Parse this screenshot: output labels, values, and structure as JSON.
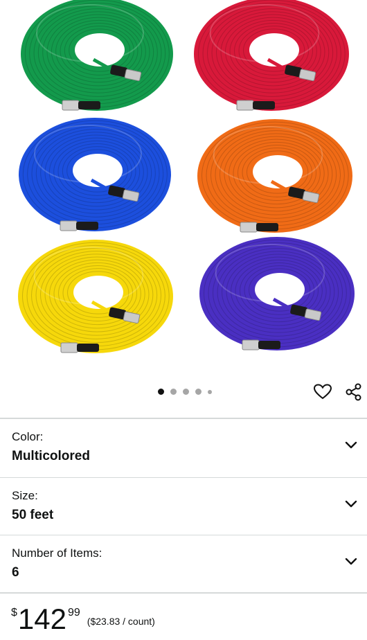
{
  "gallery": {
    "cable_colors": [
      "#139a4c",
      "#d8193a",
      "#1c4fdd",
      "#f06b16",
      "#f6d80b",
      "#4a2fc2"
    ],
    "dot_count": 5,
    "active_dot": 0
  },
  "options": [
    {
      "label": "Color:",
      "value": "Multicolored"
    },
    {
      "label": "Size:",
      "value": "50 feet"
    },
    {
      "label": "Number of Items:",
      "value": "6"
    }
  ],
  "price": {
    "currency": "$",
    "whole": "142",
    "fraction": "99",
    "unit_price": "($23.83 / count)"
  }
}
